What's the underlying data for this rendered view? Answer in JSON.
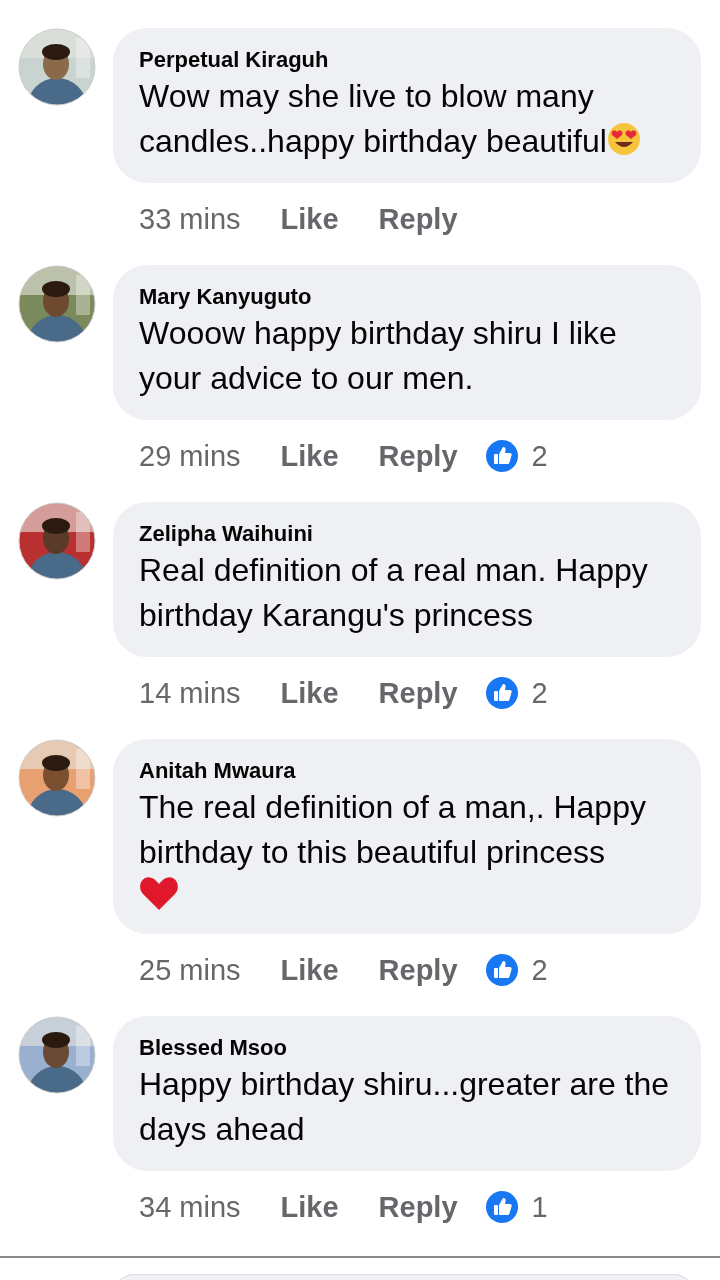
{
  "comments": [
    {
      "author": "Perpetual Kiraguh",
      "text": "Wow may she live to blow many candles..happy birthday beautiful",
      "emoji": {
        "kind": "heart_eyes"
      },
      "time": "33 mins",
      "like": "Like",
      "reply": "Reply"
    },
    {
      "author": "Mary Kanyuguto",
      "text": "Wooow happy birthday shiru I like your advice to our men.",
      "time": "29 mins",
      "like": "Like",
      "reply": "Reply",
      "reactions": "2"
    },
    {
      "author": "Zelipha Waihuini",
      "text": "Real definition of a real man. Happy birthday Karangu's princess",
      "time": "14 mins",
      "like": "Like",
      "reply": "Reply",
      "reactions": "2"
    },
    {
      "author": "Anitah Mwaura",
      "text": "The real definition of a man,. Happy birthday to this beautiful princess",
      "emoji": {
        "kind": "heart"
      },
      "time": "25 mins",
      "like": "Like",
      "reply": "Reply",
      "reactions": "2"
    },
    {
      "author": "Blessed Msoo",
      "text": "Happy birthday shiru...greater are the days ahead",
      "time": "34 mins",
      "like": "Like",
      "reply": "Reply",
      "reactions": "1"
    }
  ]
}
